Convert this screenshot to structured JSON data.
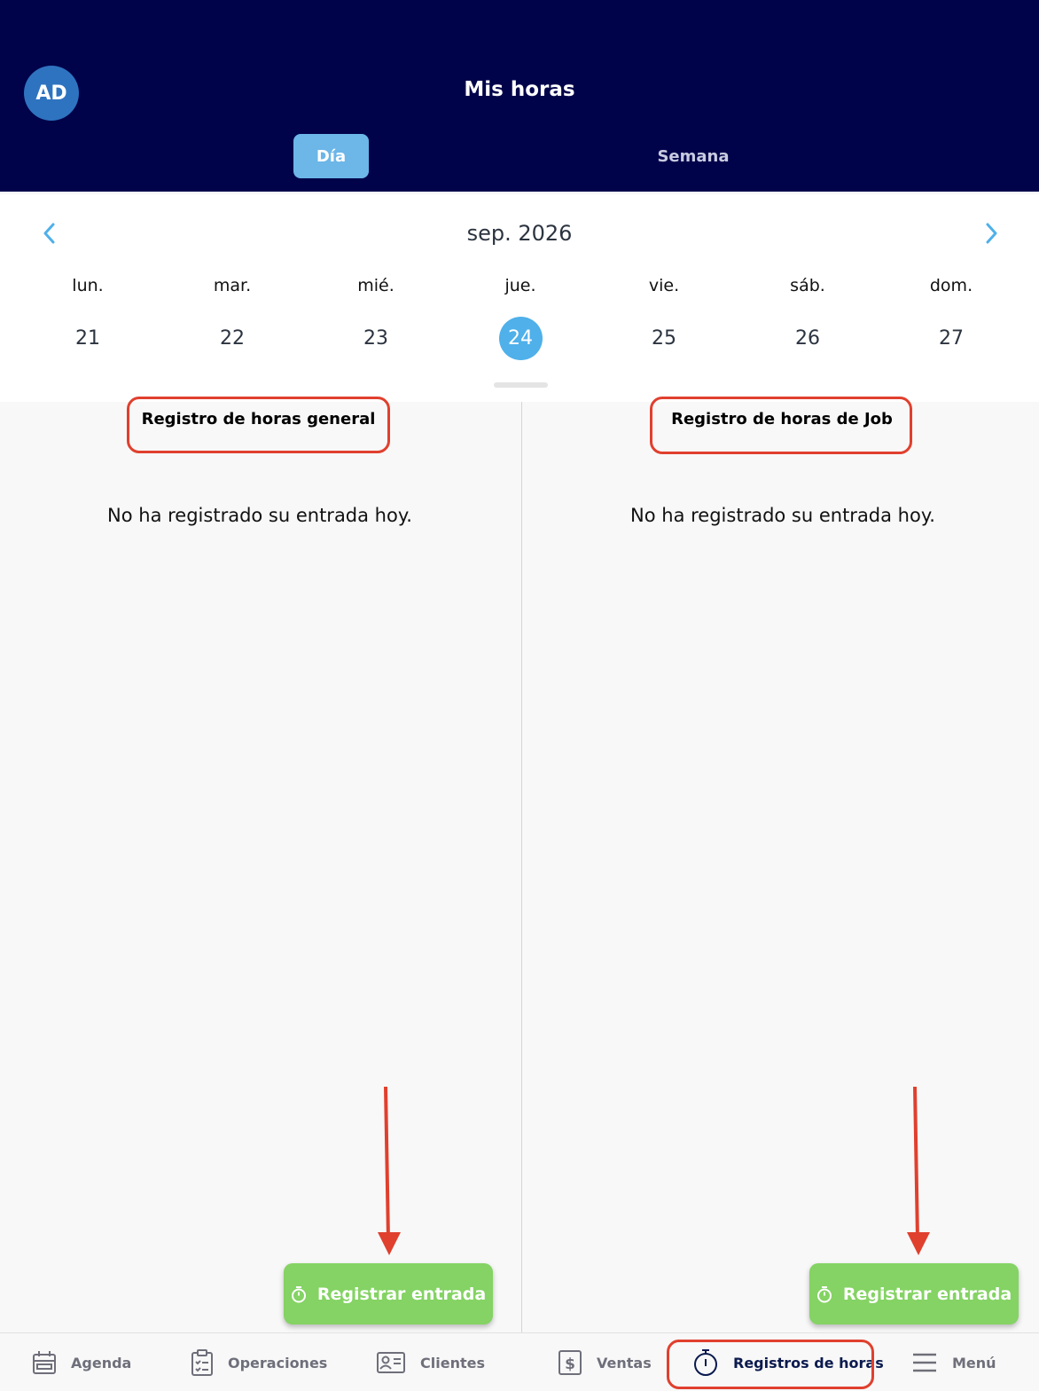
{
  "header": {
    "avatar_initials": "AD",
    "title": "Mis horas",
    "segments": {
      "day": "Día",
      "week": "Semana"
    }
  },
  "calendar": {
    "month_label": "sep. 2026",
    "weekdays": [
      "lun.",
      "mar.",
      "mié.",
      "jue.",
      "vie.",
      "sáb.",
      "dom."
    ],
    "days": [
      "21",
      "22",
      "23",
      "24",
      "25",
      "26",
      "27"
    ],
    "selected_day": "24"
  },
  "panels": {
    "general": {
      "title": "Registro de horas general",
      "empty_message": "No ha registrado su entrada hoy.",
      "button_label": "Registrar entrada"
    },
    "job": {
      "title": "Registro de horas de Job",
      "empty_message": "No ha registrado su entrada hoy.",
      "button_label": "Registrar entrada"
    }
  },
  "bottom_nav": {
    "items": [
      {
        "label": "Agenda",
        "icon": "calendar-icon"
      },
      {
        "label": "Operaciones",
        "icon": "clipboard-icon"
      },
      {
        "label": "Clientes",
        "icon": "contact-card-icon"
      },
      {
        "label": "Ventas",
        "icon": "dollar-icon"
      },
      {
        "label": "Registros de horas",
        "icon": "stopwatch-icon",
        "active": true
      },
      {
        "label": "Menú",
        "icon": "hamburger-icon"
      }
    ]
  },
  "colors": {
    "header_bg": "#00034a",
    "accent_blue": "#4fb0ea",
    "green_button": "#84d364",
    "annotation_red": "#e0402e"
  }
}
